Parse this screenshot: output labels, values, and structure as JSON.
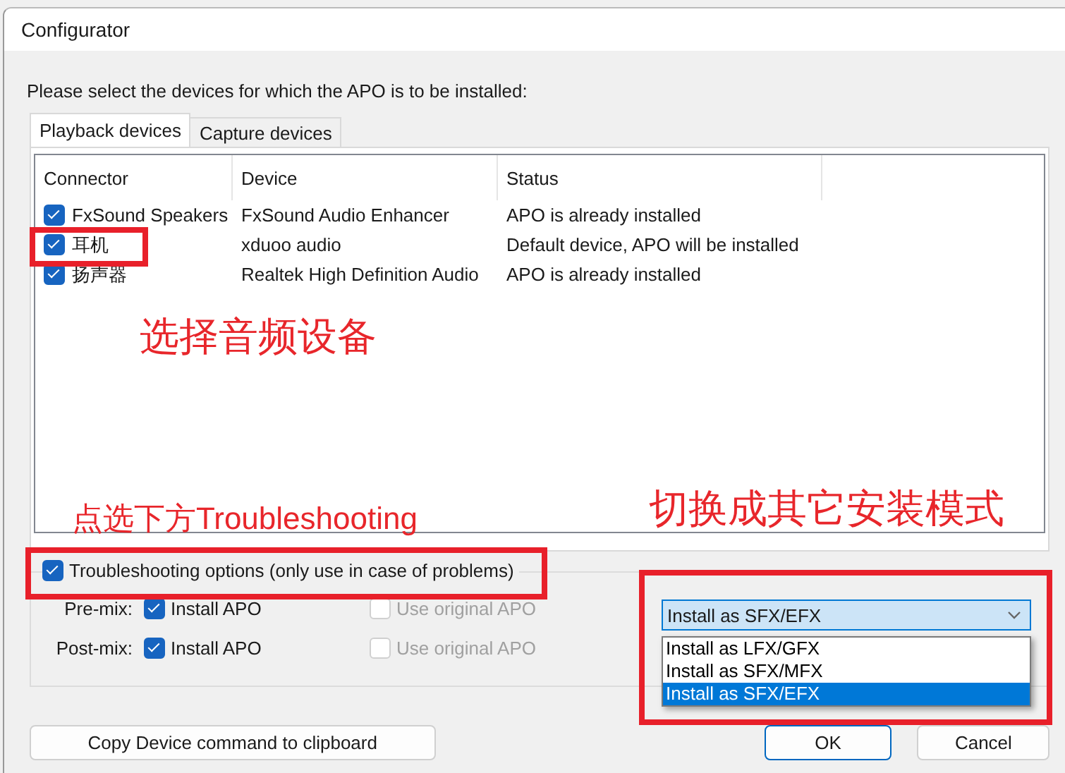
{
  "window": {
    "title": "Configurator"
  },
  "prompt": "Please select the devices for which the APO is to be installed:",
  "tabs": [
    {
      "label": "Playback devices",
      "selected": true
    },
    {
      "label": "Capture devices",
      "selected": false
    }
  ],
  "columns": [
    "Connector",
    "Device",
    "Status"
  ],
  "rows": [
    {
      "connector": "FxSound Speakers",
      "device": "FxSound Audio Enhancer",
      "status": "APO is already installed",
      "checked": true
    },
    {
      "connector": "耳机",
      "device": "xduoo audio",
      "status": "Default device, APO will be installed",
      "checked": true
    },
    {
      "connector": "扬声器",
      "device": "Realtek High Definition Audio",
      "status": "APO is already installed",
      "checked": true
    }
  ],
  "troubleshooting": {
    "label": "Troubleshooting options (only use in case of problems)",
    "checked": true
  },
  "mix_rows": [
    {
      "label": "Pre-mix:",
      "install": {
        "label": "Install APO",
        "checked": true
      },
      "original": {
        "label": "Use original APO",
        "checked": false,
        "disabled": true
      }
    },
    {
      "label": "Post-mix:",
      "install": {
        "label": "Install APO",
        "checked": true
      },
      "original": {
        "label": "Use original APO",
        "checked": false,
        "disabled": true
      }
    }
  ],
  "mode_select": {
    "value": "Install as SFX/EFX",
    "expanded": true,
    "options": [
      {
        "label": "Install as LFX/GFX",
        "selected": false
      },
      {
        "label": "Install as SFX/MFX",
        "selected": false
      },
      {
        "label": "Install as SFX/EFX",
        "selected": true
      }
    ]
  },
  "buttons": {
    "copy": "Copy Device command to clipboard",
    "ok": "OK",
    "cancel": "Cancel"
  },
  "annotations": [
    "选择音频设备",
    "点选下方Troubleshooting",
    "切换成其它安装模式"
  ]
}
